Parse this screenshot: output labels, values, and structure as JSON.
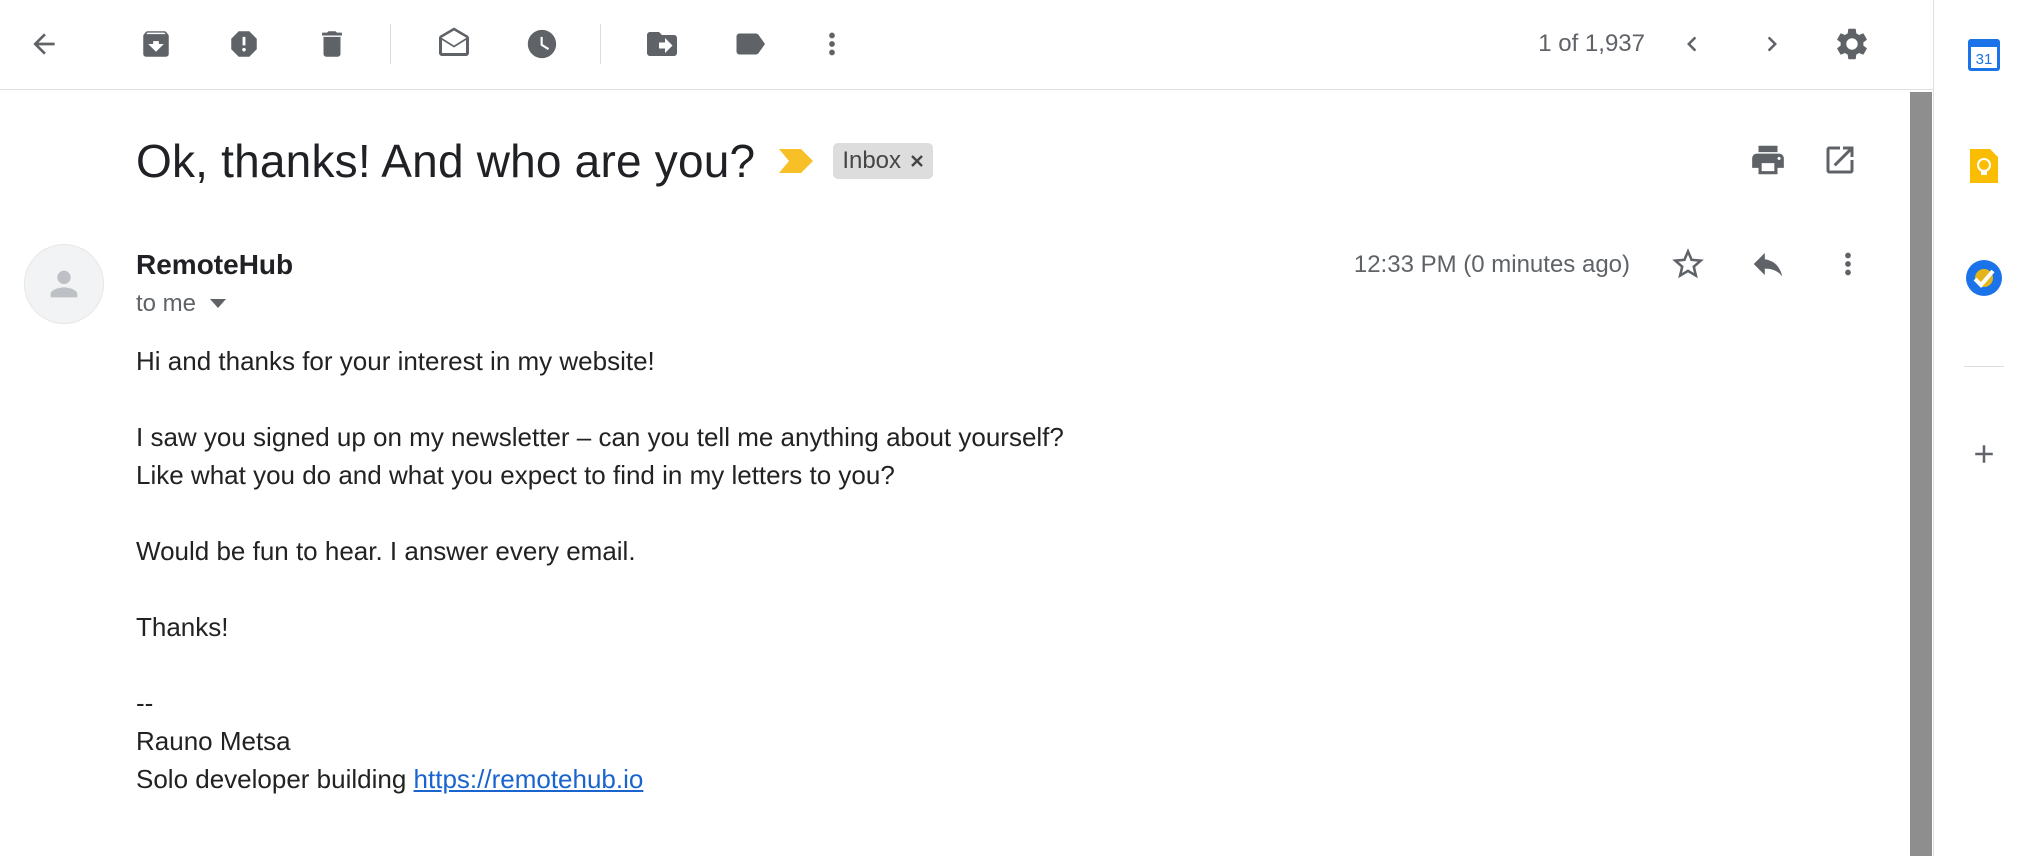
{
  "toolbar": {
    "back_icon": "arrow-back-icon",
    "archive_icon": "archive-icon",
    "spam_icon": "report-spam-icon",
    "delete_icon": "delete-icon",
    "mark_unread_icon": "mark-unread-icon",
    "snooze_icon": "snooze-icon",
    "move_to_icon": "move-to-icon",
    "labels_icon": "label-icon",
    "more_icon": "more-vert-icon",
    "pager_text": "1 of 1,937",
    "newer_icon": "chevron-left-icon",
    "older_icon": "chevron-right-icon",
    "settings_icon": "gear-icon"
  },
  "message": {
    "subject": "Ok, thanks! And who are you?",
    "label": "Inbox",
    "sender": "RemoteHub",
    "recipient": "to me",
    "timestamp": "12:33 PM (0 minutes ago)",
    "body": {
      "greeting": "Hi and thanks for your interest in my website!",
      "para1_line1": "I saw you signed up on my newsletter – can you tell me anything about yourself?",
      "para1_line2": "Like what you do and what you expect to find in my letters to you?",
      "para2": "Would be fun to hear. I answer every email.",
      "thanks": "Thanks!",
      "sig_sep": "--",
      "sig_name": "Rauno Metsa",
      "sig_prefix": "Solo developer building ",
      "sig_link": "https://remotehub.io"
    }
  },
  "side_panel": {
    "items": [
      "calendar-icon",
      "keep-icon",
      "tasks-icon",
      "add-icon"
    ],
    "calendar_day": "31"
  },
  "colors": {
    "importance": "#f6c026",
    "link": "#1a64cf",
    "icon_gray": "#5f6368",
    "keep_yellow": "#fbbc04",
    "tasks_blue": "#1a73e8",
    "calendar_blue": "#1a73e8"
  }
}
